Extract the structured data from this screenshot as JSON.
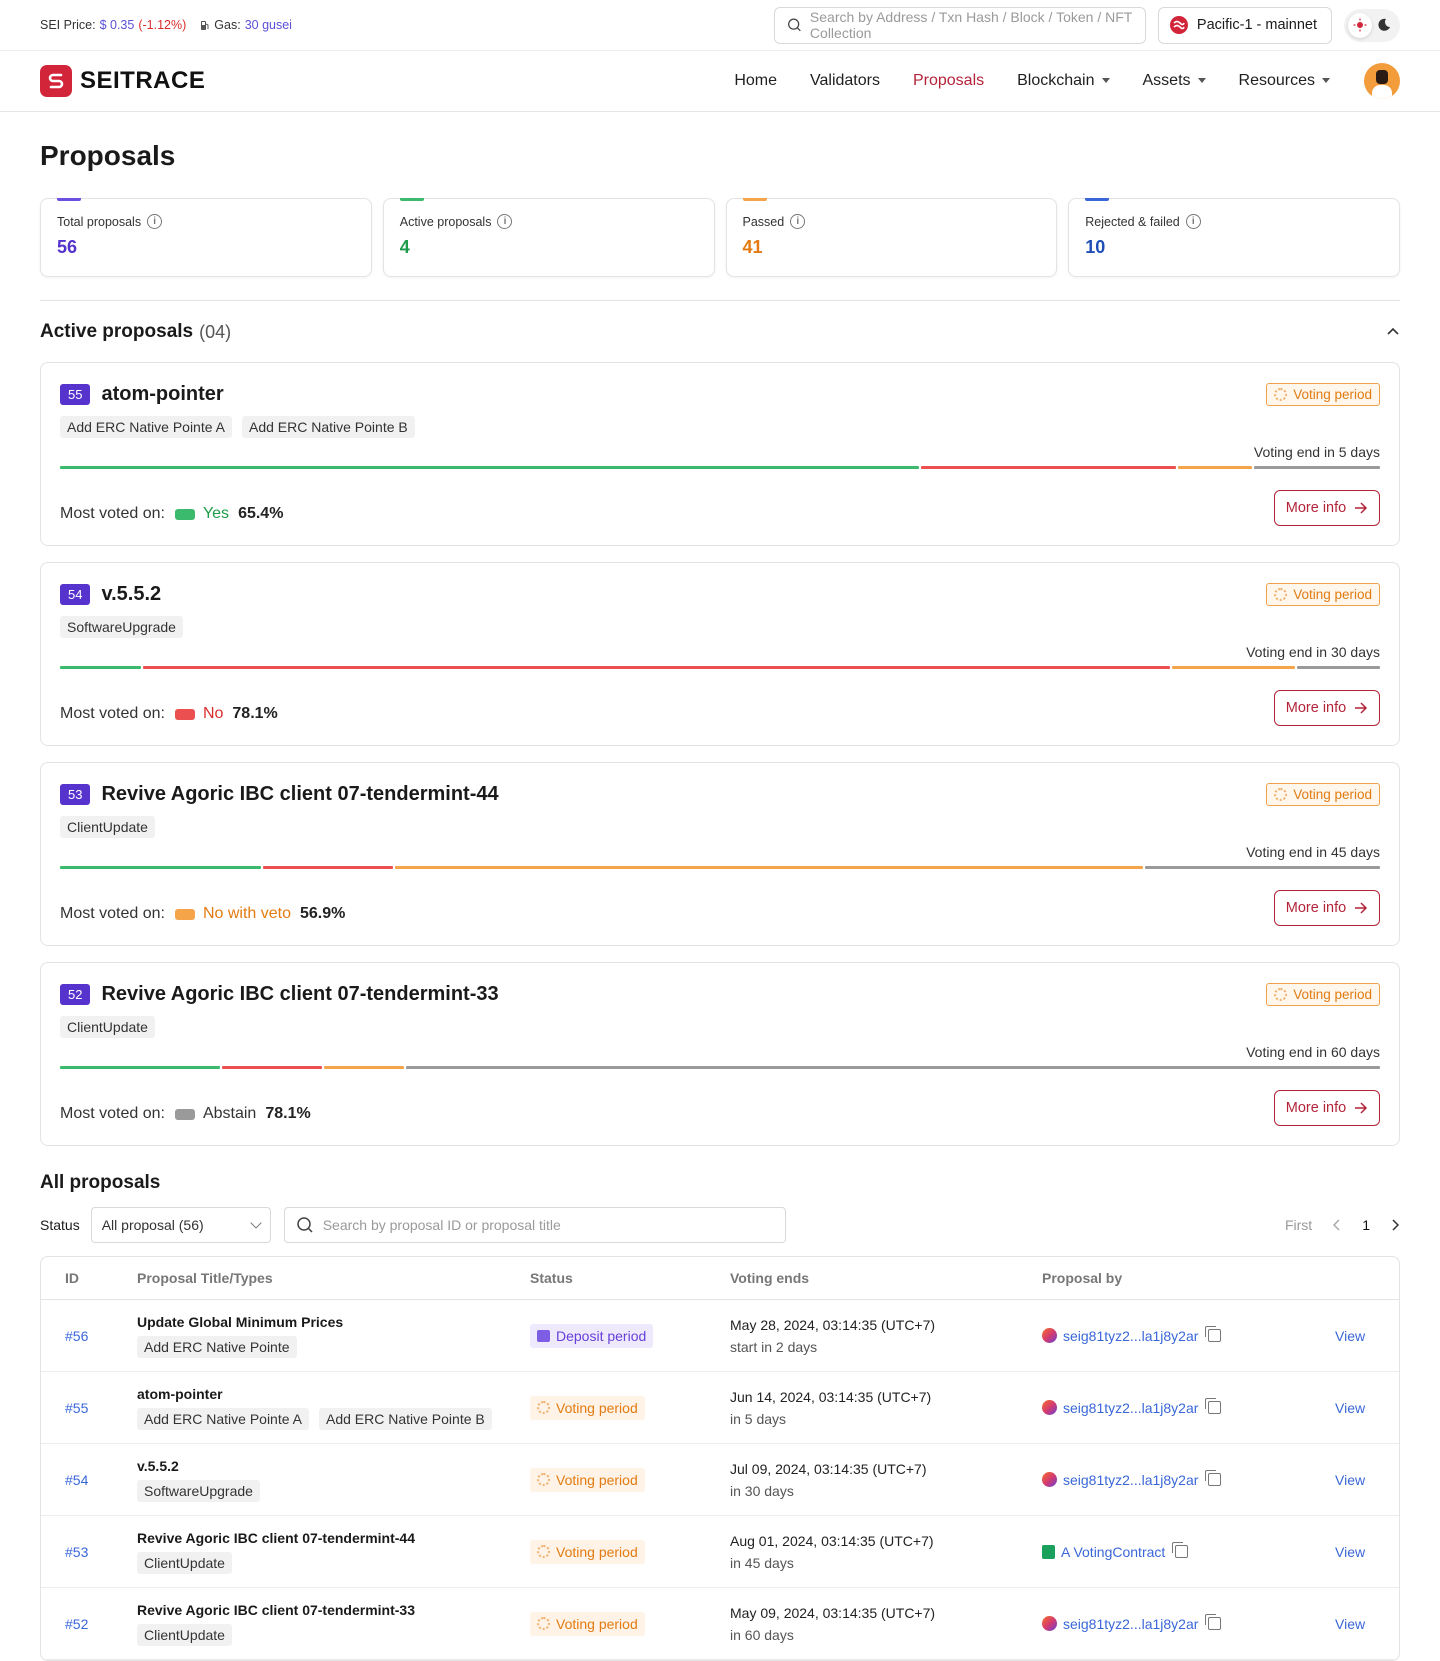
{
  "topbar": {
    "price_label": "SEI Price:",
    "price_value": "$ 0.35",
    "price_change": "(-1.12%)",
    "gas_label": "Gas:",
    "gas_value": "30 gusei",
    "search_placeholder": "Search by Address / Txn Hash / Block / Token / NFT Collection",
    "network": "Pacific-1 - mainnet"
  },
  "nav": {
    "brand": "SEITRACE",
    "items": [
      "Home",
      "Validators",
      "Proposals",
      "Blockchain",
      "Assets",
      "Resources"
    ],
    "active": "Proposals"
  },
  "page": {
    "title": "Proposals"
  },
  "stats": [
    {
      "label": "Total proposals",
      "value": "56",
      "color": "#5533cc"
    },
    {
      "label": "Active proposals",
      "value": "4",
      "color": "#1e9b4b"
    },
    {
      "label": "Passed",
      "value": "41",
      "color": "#e37b12"
    },
    {
      "label": "Rejected & failed",
      "value": "10",
      "color": "#1f4fb6"
    }
  ],
  "active_section": {
    "title": "Active proposals",
    "count": "(04)"
  },
  "vote_colors": {
    "yes": "#3bb96d",
    "no": "#ec4f4f",
    "veto": "#f5a44a",
    "abstain": "#9a9a9a"
  },
  "active_proposals": [
    {
      "id": "55",
      "title": "atom-pointer",
      "tags": [
        "Add ERC Native Pointe A",
        "Add ERC Native Pointe B"
      ],
      "status": "Voting period",
      "voting_end": "Voting end in 5 days",
      "votes": {
        "yes": 65.4,
        "no": 19.4,
        "veto": 5.6,
        "abstain": 9.6
      },
      "most_label": "Most voted on:",
      "most_option": "Yes",
      "most_pct": "65.4%",
      "most_key": "yes",
      "more": "More info"
    },
    {
      "id": "54",
      "title": "v.5.5.2",
      "tags": [
        "SoftwareUpgrade"
      ],
      "status": "Voting period",
      "voting_end": "Voting end in 30 days",
      "votes": {
        "yes": 6.2,
        "no": 78.1,
        "veto": 9.4,
        "abstain": 6.3
      },
      "most_label": "Most voted on:",
      "most_option": "No",
      "most_pct": "78.1%",
      "most_key": "no",
      "more": "More info"
    },
    {
      "id": "53",
      "title": "Revive Agoric IBC client 07-tendermint-44",
      "tags": [
        "ClientUpdate"
      ],
      "status": "Voting period",
      "voting_end": "Voting end in 45  days",
      "votes": {
        "yes": 15.3,
        "no": 9.9,
        "veto": 56.9,
        "abstain": 17.9
      },
      "most_label": "Most voted on:",
      "most_option": "No with veto",
      "most_pct": "56.9%",
      "most_key": "veto",
      "more": "More info"
    },
    {
      "id": "52",
      "title": "Revive Agoric IBC client 07-tendermint-33",
      "tags": [
        "ClientUpdate"
      ],
      "status": "Voting period",
      "voting_end": "Voting end in 60 days",
      "votes": {
        "yes": 12.2,
        "no": 7.6,
        "veto": 6.1,
        "abstain": 74.1
      },
      "most_label": "Most voted on:",
      "most_option": "Abstain",
      "most_pct": "78.1%",
      "most_key": "abstain",
      "more": "More info"
    }
  ],
  "all_section": {
    "title": "All proposals",
    "status_label": "Status",
    "status_value": "All proposal (56)",
    "search_placeholder": "Search by proposal ID or proposal title",
    "pager_first": "First",
    "pager_page": "1"
  },
  "table": {
    "columns": [
      "ID",
      "Proposal Title/Types",
      "Status",
      "Voting ends",
      "Proposal by",
      ""
    ],
    "rows": [
      {
        "id": "#56",
        "title": "Update Global Minimum Prices",
        "tags": [
          "Add ERC Native Pointe"
        ],
        "status": "Deposit period",
        "status_kind": "deposit",
        "date": "May 28, 2024, 03:14:35 (UTC+7)",
        "sub": "start in 2 days",
        "by": "seig81tyz2...la1j8y2ar",
        "by_kind": "address",
        "action": "View"
      },
      {
        "id": "#55",
        "title": "atom-pointer",
        "tags": [
          "Add ERC Native Pointe A",
          "Add ERC Native Pointe B"
        ],
        "status": "Voting period",
        "status_kind": "voting",
        "date": "Jun 14, 2024, 03:14:35 (UTC+7)",
        "sub": "in 5 days",
        "by": "seig81tyz2...la1j8y2ar",
        "by_kind": "address",
        "action": "View"
      },
      {
        "id": "#54",
        "title": "v.5.5.2",
        "tags": [
          "SoftwareUpgrade"
        ],
        "status": "Voting period",
        "status_kind": "voting",
        "date": "Jul 09, 2024, 03:14:35 (UTC+7)",
        "sub": "in 30 days",
        "by": "seig81tyz2...la1j8y2ar",
        "by_kind": "address",
        "action": "View"
      },
      {
        "id": "#53",
        "title": "Revive Agoric IBC client 07-tendermint-44",
        "tags": [
          "ClientUpdate"
        ],
        "status": "Voting period",
        "status_kind": "voting",
        "date": "Aug 01, 2024, 03:14:35 (UTC+7)",
        "sub": "in 45 days",
        "by": "A VotingContract",
        "by_kind": "contract",
        "action": "View"
      },
      {
        "id": "#52",
        "title": "Revive Agoric IBC client 07-tendermint-33",
        "tags": [
          "ClientUpdate"
        ],
        "status": "Voting period",
        "status_kind": "voting",
        "date": "May 09, 2024, 03:14:35 (UTC+7)",
        "sub": "in 60 days",
        "by": "seig81tyz2...la1j8y2ar",
        "by_kind": "address",
        "action": "View"
      }
    ]
  }
}
